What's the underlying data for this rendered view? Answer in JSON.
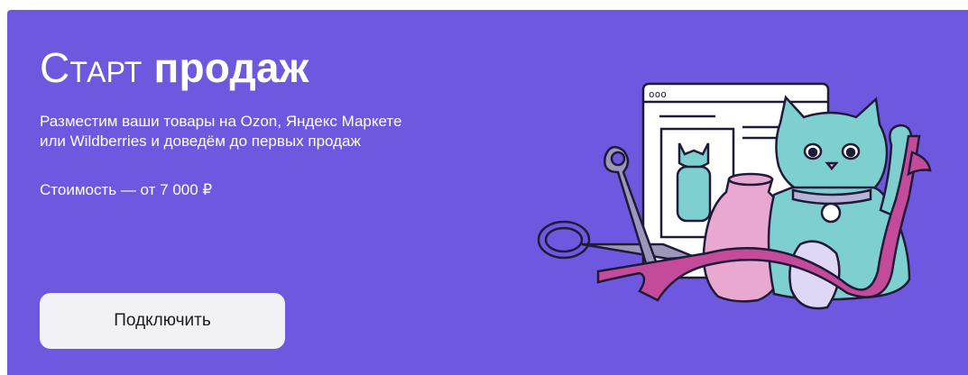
{
  "banner": {
    "title_part1": "Старт",
    "title_part2": "продаж",
    "desc_line1": "Разместим ваши товары на Ozon, Яндекс Маркете",
    "desc_line2": "или Wildberries и доведём до первых продаж",
    "price": "Стоимость — от 7 000 ₽",
    "button_label": "Подключить",
    "browser_dots": "ooo"
  },
  "colors": {
    "background": "#6e58e0",
    "button_bg": "#f2f1f5",
    "cat": "#7ecfcf",
    "ribbon": "#c44a9a",
    "vase": "#e8a8cf"
  }
}
